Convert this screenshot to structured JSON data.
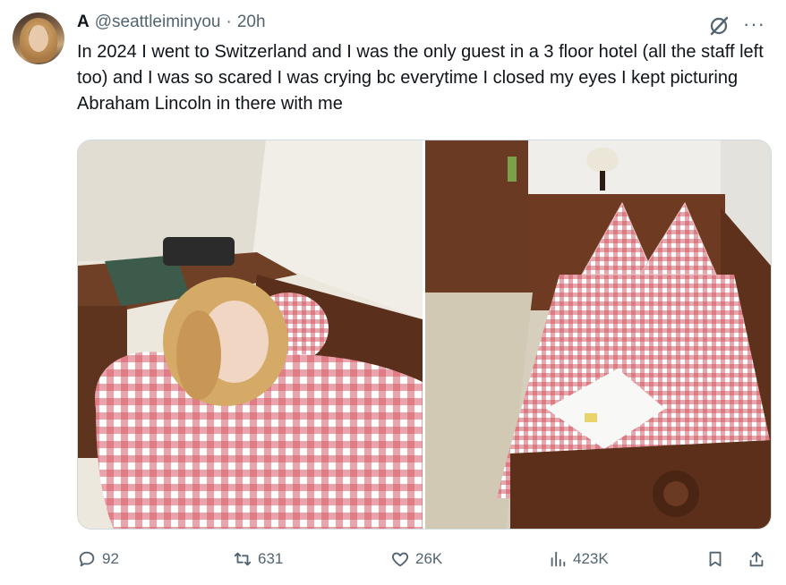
{
  "author": {
    "name": "A",
    "handle": "@seattleiminyou",
    "separator": "·",
    "time": "20h"
  },
  "tweet": {
    "text": "In 2024 I went to Switzerland and I was the only guest in a 3 floor hotel (all the staff left too) and I was so scared I was crying bc everytime I closed my eyes I kept picturing Abraham Lincoln in there with me"
  },
  "icons": {
    "grok": "grok-icon",
    "more": "more-icon",
    "reply": "reply-icon",
    "retweet": "retweet-icon",
    "like": "heart-icon",
    "views": "views-icon",
    "bookmark": "bookmark-icon",
    "share": "share-icon"
  },
  "actions": {
    "replies": "92",
    "retweets": "631",
    "likes": "26K",
    "views": "423K"
  },
  "colors": {
    "text": "#0f1419",
    "secondary": "#536471",
    "gingham": "#d0505b"
  }
}
